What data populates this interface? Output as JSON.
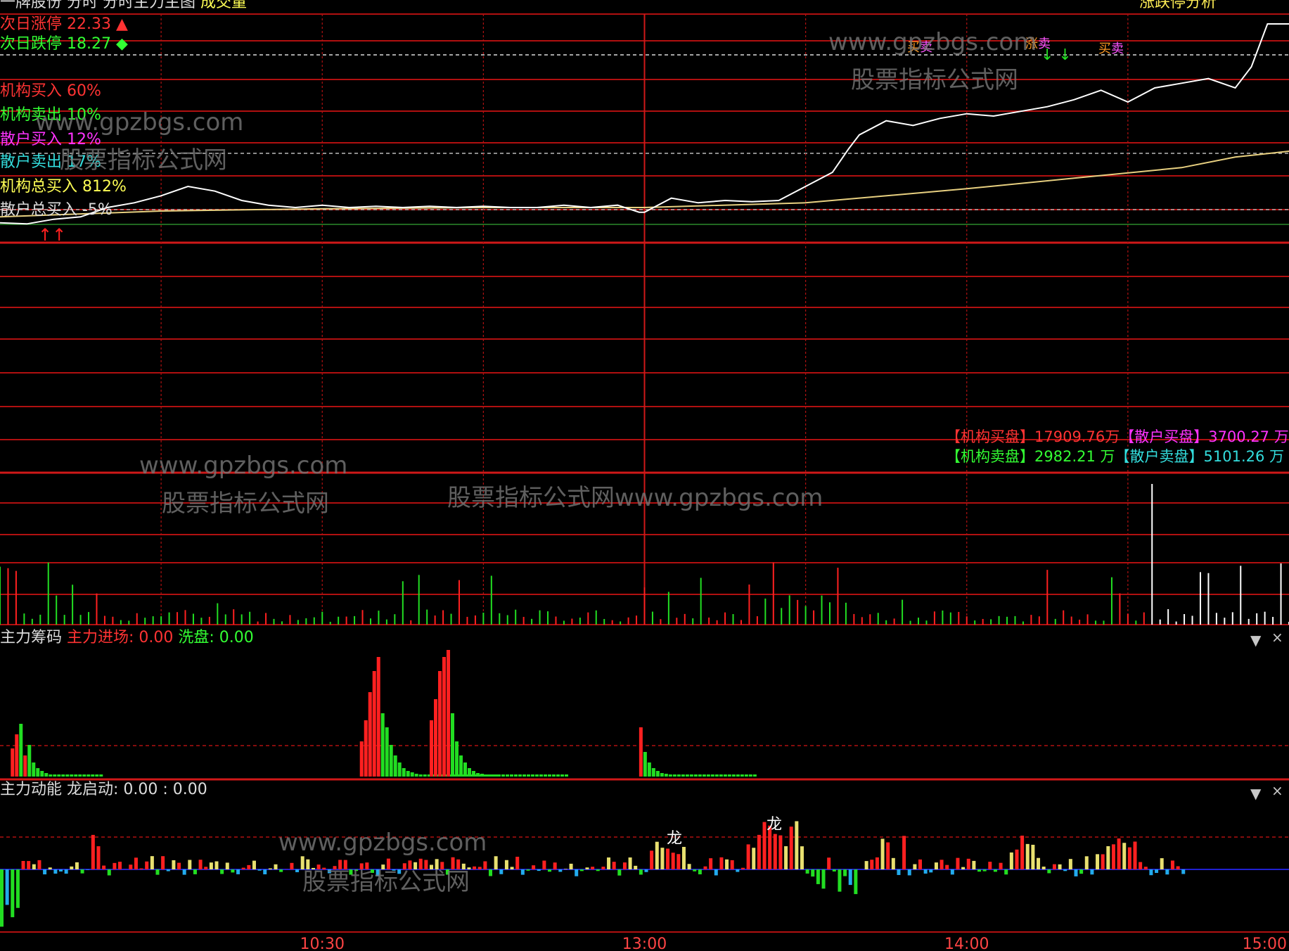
{
  "header": {
    "title_parts": [
      "一牌股份",
      "分时",
      "分时主力主图",
      "成交量"
    ],
    "right_label": "涨跌停分析"
  },
  "price_panel": {
    "next_limit_up": "次日涨停 22.33",
    "next_limit_down": "次日跌停 18.27",
    "limit_up_marker": "▲",
    "limit_down_marker": "◆",
    "stats": [
      {
        "label": "机构买入 60%",
        "color": "#ff3333"
      },
      {
        "label": "机构卖出 10%",
        "color": "#33ff33"
      },
      {
        "label": "散户买入 12%",
        "color": "#ff33ff"
      },
      {
        "label": "散户卖出 17%",
        "color": "#33dddd"
      },
      {
        "label": "机构总买入 812%",
        "color": "#ffff55"
      },
      {
        "label": "散户总买入 -5%",
        "color": "#dddddd"
      }
    ],
    "signal_chars": [
      "买",
      "卖",
      "涨",
      "卖",
      "买",
      "卖"
    ]
  },
  "order_panel": {
    "inst_buy": "【机构买盘】17909.76万",
    "retail_buy": "【散户买盘】3700.27 万",
    "inst_sell": "【机构卖盘】2982.21 万",
    "retail_sell": "【散户卖盘】5101.26 万"
  },
  "indicator1": {
    "name": "主力筹码",
    "field1": "主力进场: 0.00",
    "field2": "洗盘: 0.00"
  },
  "indicator2": {
    "name": "主力动能",
    "field1": "龙启动: 0.00",
    "field2": ": 0.00",
    "dragon_char": "龙"
  },
  "controls": {
    "dropdown_icon": "▼",
    "close_icon": "×"
  },
  "watermarks": [
    "www.gpzbgs.com",
    "股票指标公式网",
    "股票指标公式网www.gpzbgs.com"
  ],
  "colors": {
    "grid": "#b01010",
    "price_line": "#ffffff",
    "avg_line": "#e8d080",
    "up_bar": "#ff2020",
    "down_bar": "#22dd22",
    "yellow_bar": "#e8e070",
    "cyan_bar": "#22aaee"
  },
  "chart_data": {
    "type": "line",
    "x_ticks": [
      "10:30",
      "13:00",
      "14:00",
      "15:00"
    ],
    "x_tick_minutes": [
      60,
      120,
      180,
      240
    ],
    "price_series": {
      "t": [
        0,
        5,
        10,
        15,
        20,
        25,
        30,
        35,
        40,
        45,
        50,
        55,
        60,
        65,
        70,
        75,
        80,
        85,
        90,
        95,
        100,
        105,
        110,
        115,
        119,
        120,
        125,
        130,
        135,
        140,
        145,
        150,
        155,
        158,
        160,
        165,
        170,
        175,
        180,
        185,
        190,
        195,
        200,
        205,
        210,
        215,
        220,
        225,
        230,
        233,
        236,
        240
      ],
      "y": [
        13.85,
        13.8,
        14.0,
        14.1,
        14.5,
        14.7,
        15.0,
        15.4,
        15.2,
        14.8,
        14.6,
        14.5,
        14.6,
        14.5,
        14.55,
        14.5,
        14.55,
        14.5,
        14.55,
        14.5,
        14.5,
        14.6,
        14.5,
        14.6,
        14.3,
        14.3,
        14.9,
        14.7,
        14.8,
        14.75,
        14.8,
        15.4,
        16.0,
        17.0,
        17.6,
        18.2,
        18.0,
        18.3,
        18.5,
        18.4,
        18.6,
        18.8,
        19.1,
        19.5,
        19.0,
        19.6,
        19.8,
        20.0,
        19.6,
        20.5,
        22.33,
        22.33
      ]
    },
    "avg_series": {
      "t": [
        0,
        30,
        60,
        90,
        120,
        150,
        180,
        200,
        220,
        230,
        240
      ],
      "y": [
        14.1,
        14.35,
        14.45,
        14.5,
        14.5,
        14.7,
        15.3,
        15.75,
        16.2,
        16.65,
        16.9
      ]
    }
  }
}
